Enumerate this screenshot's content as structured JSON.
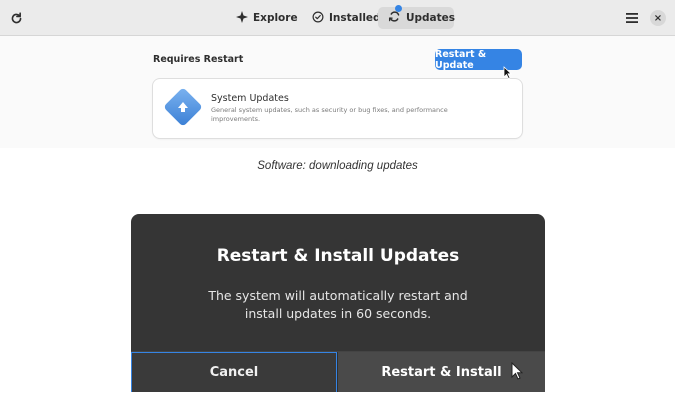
{
  "software_app": {
    "header": {
      "tabs": [
        {
          "label": "Explore",
          "icon": "star-icon",
          "active": false
        },
        {
          "label": "Installed",
          "icon": "check-circle-icon",
          "active": false
        },
        {
          "label": "Updates",
          "icon": "updates-sync-icon",
          "active": true
        }
      ],
      "left_icon": "refresh-icon",
      "right_icons": [
        "menu-icon",
        "close-icon"
      ]
    },
    "section_title": "Requires Restart",
    "restart_button_label": "Restart & Update",
    "update_card": {
      "title": "System Updates",
      "description": "General system updates, such as security or bug fixes, and performance improvements.",
      "icon": "system-update-diamond-icon"
    },
    "accent_color": "#3584e4"
  },
  "caption_top": "Software: downloading updates",
  "restart_dialog": {
    "title": "Restart & Install Updates",
    "body": "The system will automatically restart and install updates in 60 seconds.",
    "cancel_label": "Cancel",
    "confirm_label": "Restart & Install",
    "background_color": "#353535"
  }
}
